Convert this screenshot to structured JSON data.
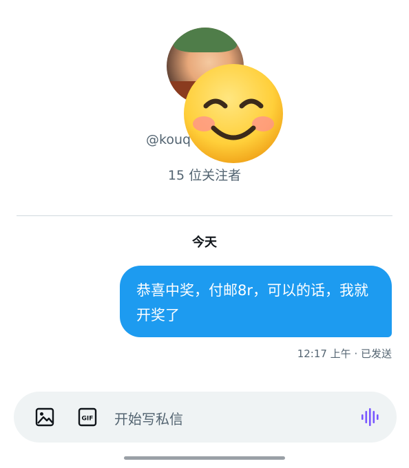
{
  "profile": {
    "handle": "@kouq",
    "followers": "15 位关注者"
  },
  "conversation": {
    "day_label": "今天",
    "messages": [
      {
        "text": "恭喜中奖，付邮8r，可以的话，我就开奖了",
        "meta": "12:17 上午 · 已发送",
        "sender": "me"
      }
    ]
  },
  "composer": {
    "placeholder": "开始写私信",
    "icons": [
      "image-icon",
      "gif-icon",
      "voice-icon"
    ]
  },
  "colors": {
    "bubble": "#1d9bf0",
    "accent_voice": "#7856ff",
    "muted_text": "#536471"
  }
}
